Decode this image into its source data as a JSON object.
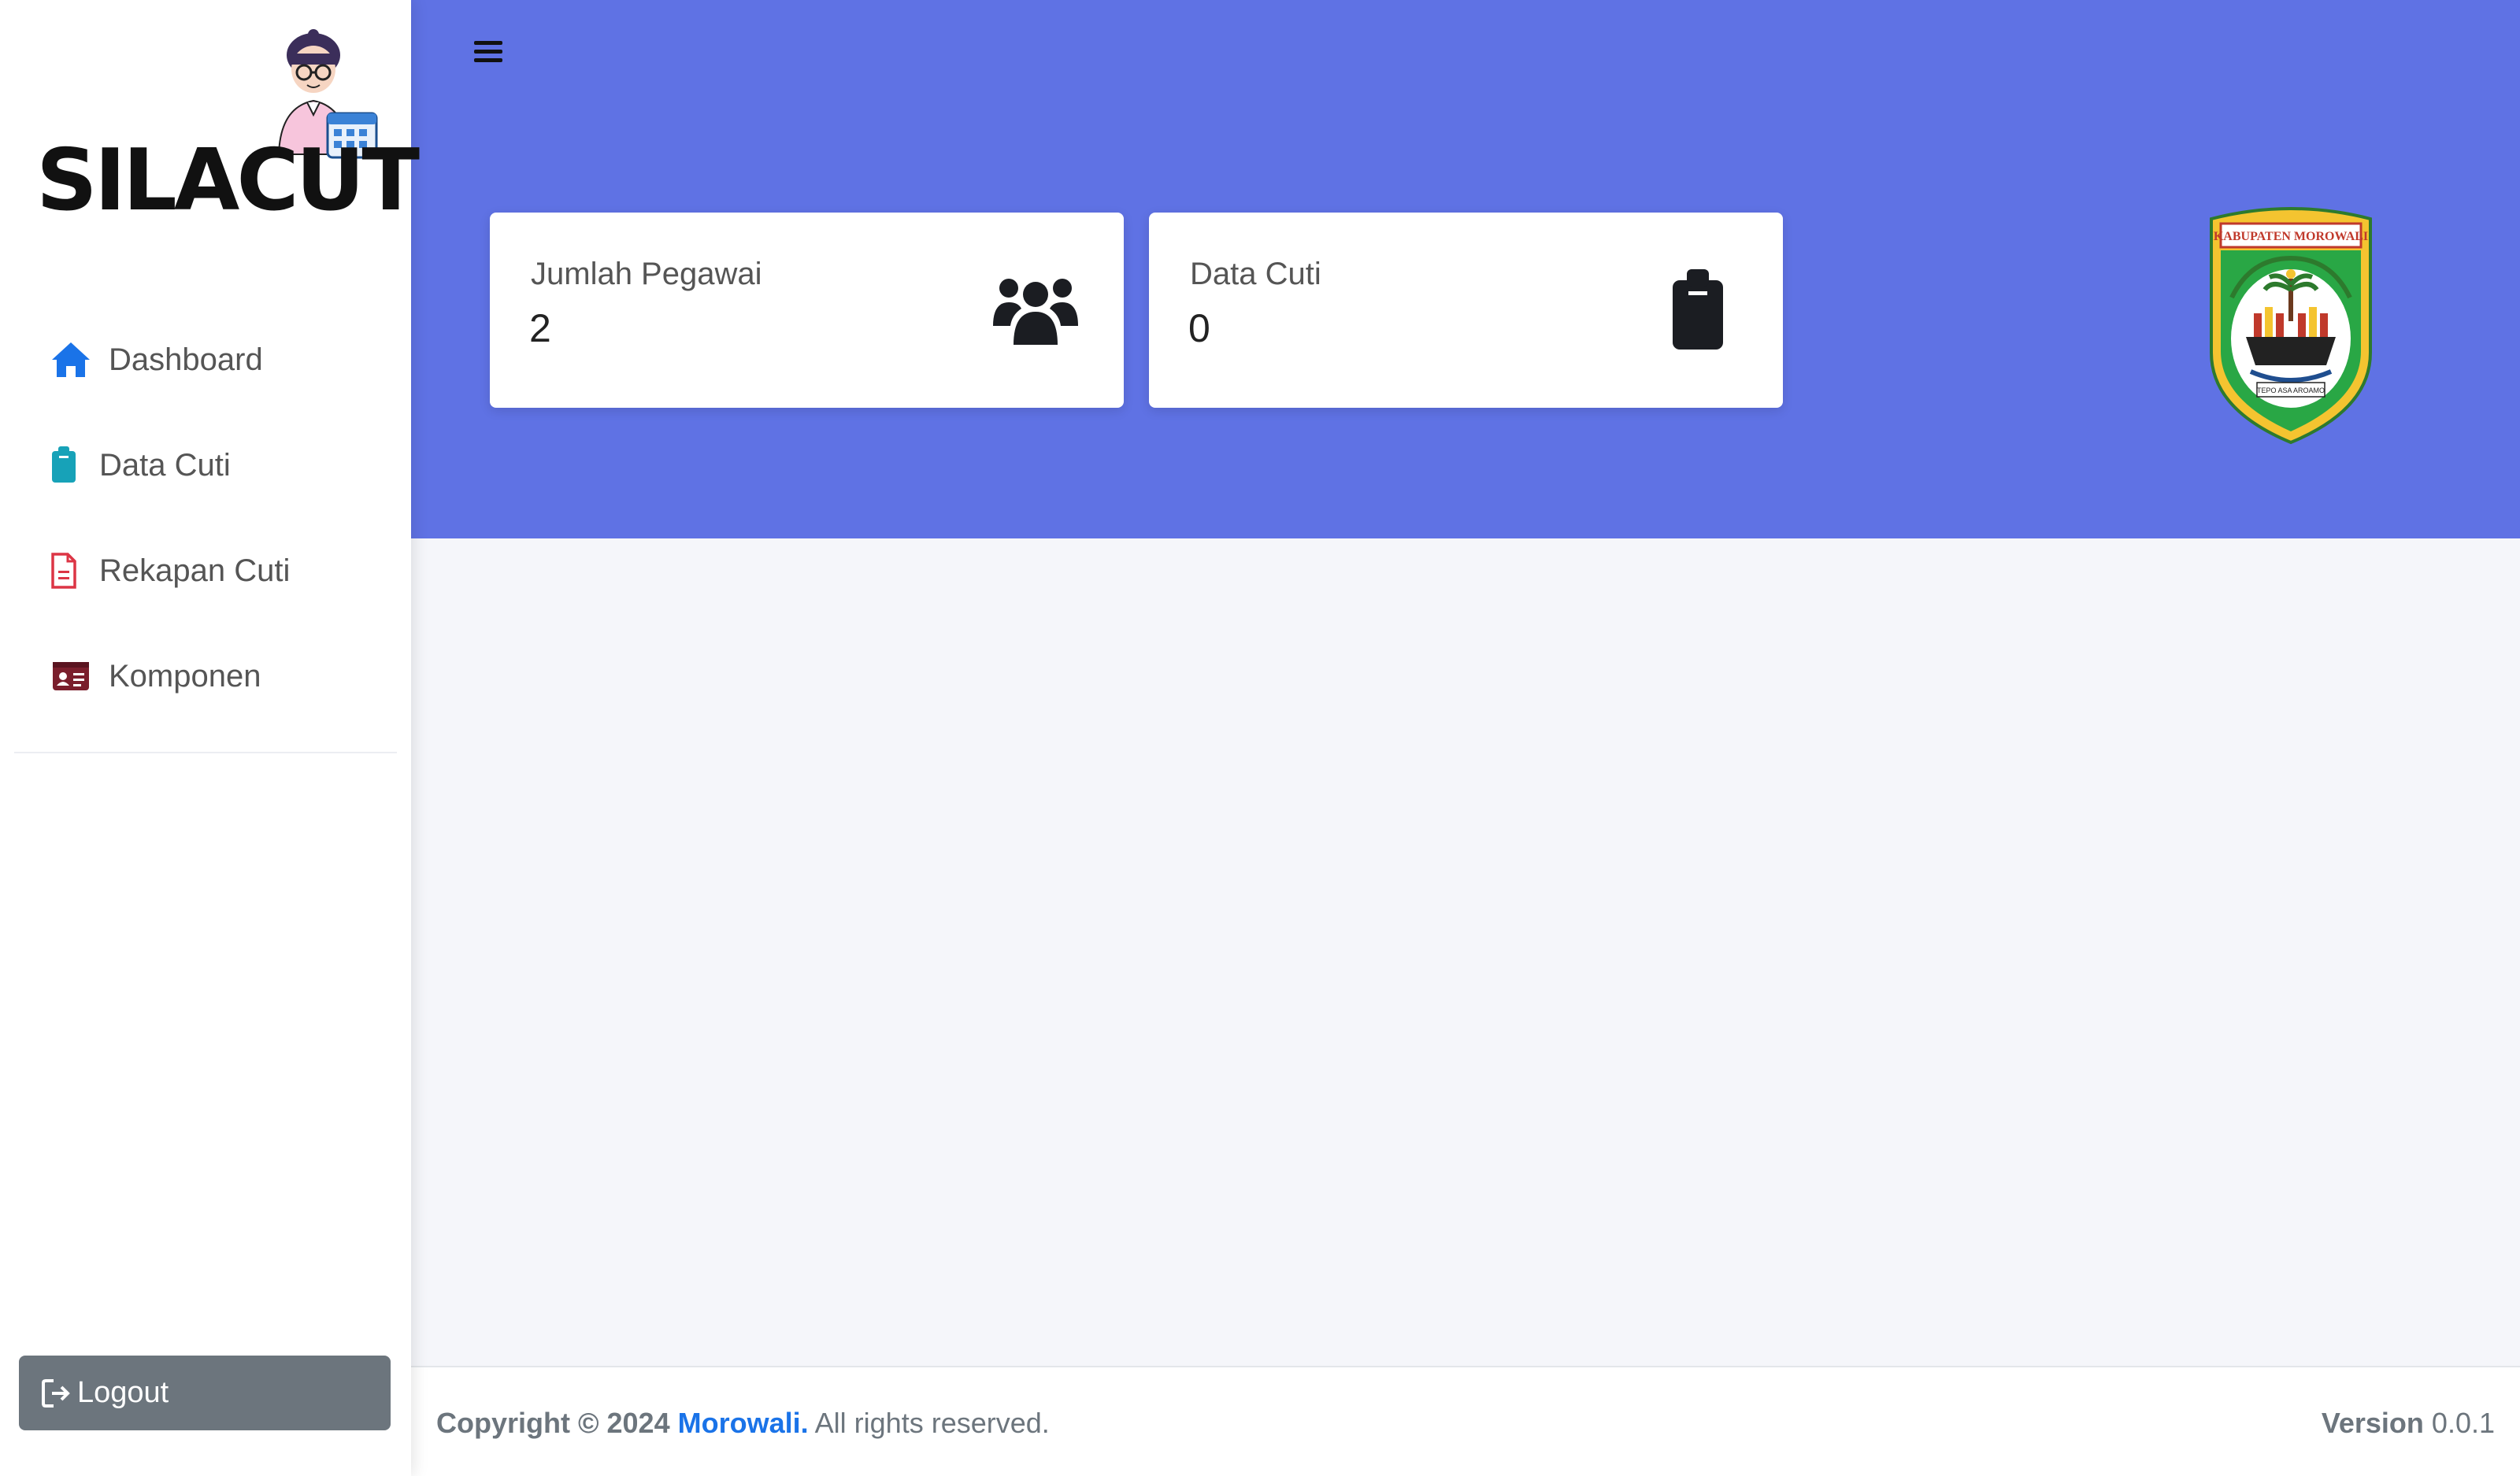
{
  "brand": {
    "name": "SILACUT"
  },
  "sidebar": {
    "items": [
      {
        "label": "Dashboard",
        "icon": "home-icon",
        "color": "#1a73e8"
      },
      {
        "label": "Data Cuti",
        "icon": "clipboard-icon",
        "color": "#17a2b8"
      },
      {
        "label": "Rekapan Cuti",
        "icon": "file-icon",
        "color": "#dc3545"
      },
      {
        "label": "Komponen",
        "icon": "id-card-icon",
        "color": "#7a1e2c"
      }
    ],
    "logout_label": "Logout"
  },
  "header": {
    "background": "#5f72e4",
    "cards": [
      {
        "title": "Jumlah Pegawai",
        "value": "2",
        "icon": "users-icon"
      },
      {
        "title": "Data Cuti",
        "value": "0",
        "icon": "clipboard-icon"
      }
    ],
    "emblem_text": "KABUPATEN MOROWALI",
    "emblem_motto": "TEPO ASA AROAMO"
  },
  "footer": {
    "copyright_prefix": "Copyright © 2024",
    "link_text": "Morowali.",
    "suffix": "All rights reserved.",
    "version_label": "Version",
    "version_number": "0.0.1"
  }
}
